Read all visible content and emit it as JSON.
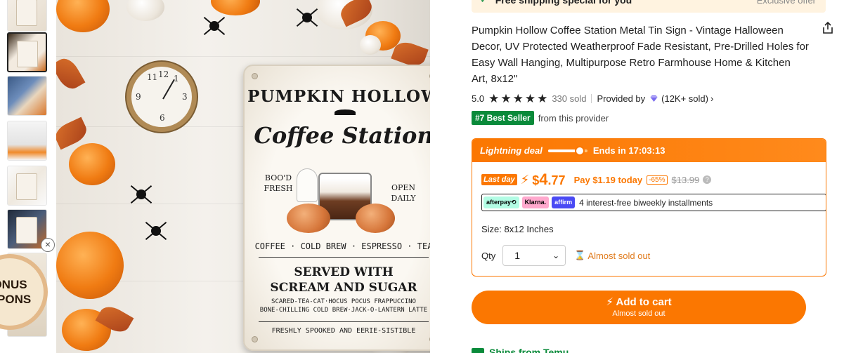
{
  "thumbnails": {
    "count": 7,
    "active_index": 1
  },
  "coupon_badge": {
    "line1": "ONUS",
    "line2": "UPONS"
  },
  "hero_sign": {
    "title": "PUMPKIN HOLLOW",
    "script": "Coffee Station",
    "left_text": "BOO'D FRESH",
    "right_text": "OPEN DAILY",
    "menu": "COFFEE · COLD BREW · ESPRESSO · TEA",
    "served_line1": "SERVED WITH",
    "served_line2": "SCREAM AND SUGAR",
    "small_line1": "SCARED-TEA-CAT·HOCUS POCUS FRAPPUCCINO",
    "small_line2": "BONE-CHILLING COLD BREW·JACK-O-LANTERN LATTE",
    "footer": "FRESHLY SPOOKED AND EERIE-SISTIBLE",
    "clock_numbers": [
      "11",
      "12",
      "1",
      "9",
      "3",
      "6"
    ]
  },
  "promo": {
    "text": "Free shipping special for you",
    "right": "Exclusive offer"
  },
  "product": {
    "title": "Pumpkin Hollow Coffee Station Metal Tin Sign - Vintage Halloween Decor, UV Protected Weatherproof Fade Resistant, Pre-Drilled Holes for Easy Wall Hanging, Multipurpose Retro Farmhouse Home & Kitchen Art, 8x12\"",
    "rating": "5.0",
    "stars": 5,
    "sold": "330 sold",
    "provided_by": "Provided by",
    "provider_sold": "(12K+ sold)",
    "bestseller_badge": "#7 Best Seller",
    "bestseller_tail": "from this provider"
  },
  "deal": {
    "title": "Lightning deal",
    "ends": "Ends in 17:03:13",
    "progress": 0.8,
    "last_day": "Last day",
    "price_symbol": "$",
    "price_main": "4",
    "price_cents": ".77",
    "pay_today": "Pay $1.19 today",
    "discount": "-65%",
    "original_price": "$13.99",
    "info_icon": "?",
    "installments": "4 interest-free biweekly installments",
    "chip_afterpay": "afterpay⟲",
    "chip_klarna": "Klarna.",
    "chip_affirm": "affirm",
    "size": "Size: 8x12 Inches",
    "qty_label": "Qty",
    "qty_value": "1",
    "stock": "Almost sold out"
  },
  "cart": {
    "label": "Add to cart",
    "sub": "Almost sold out"
  },
  "shipping": {
    "label": "Ships from Temu"
  },
  "colors": {
    "accent": "#fb7701",
    "green": "#0a8a3a"
  }
}
